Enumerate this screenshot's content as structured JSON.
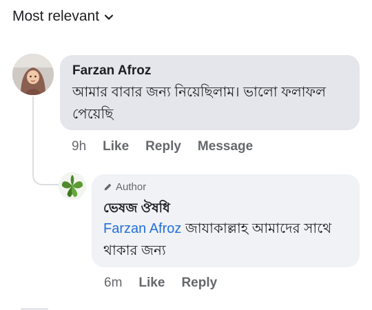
{
  "sort": {
    "label": "Most relevant"
  },
  "comment": {
    "author": "Farzan Afroz",
    "text": "আমার বাবার জন্য নিয়েছিলাম। ভালো ফলাফল পেয়েছি",
    "time": "9h",
    "actions": [
      "Like",
      "Reply",
      "Message"
    ]
  },
  "reply": {
    "badge": "Author",
    "author": "ভেষজ ঔষধি",
    "mention": "Farzan Afroz",
    "text": " জাযাকাল্লাহ আমাদের সাথে থাকার জন্য",
    "time": "6m",
    "actions": [
      "Like",
      "Reply"
    ]
  },
  "icons": {
    "sort_chevron": "chevron-down-icon",
    "author_badge": "pencil-icon"
  },
  "colors": {
    "mention": "#216fdb",
    "muted": "#65676b",
    "bubble": "#f0f2f5"
  }
}
